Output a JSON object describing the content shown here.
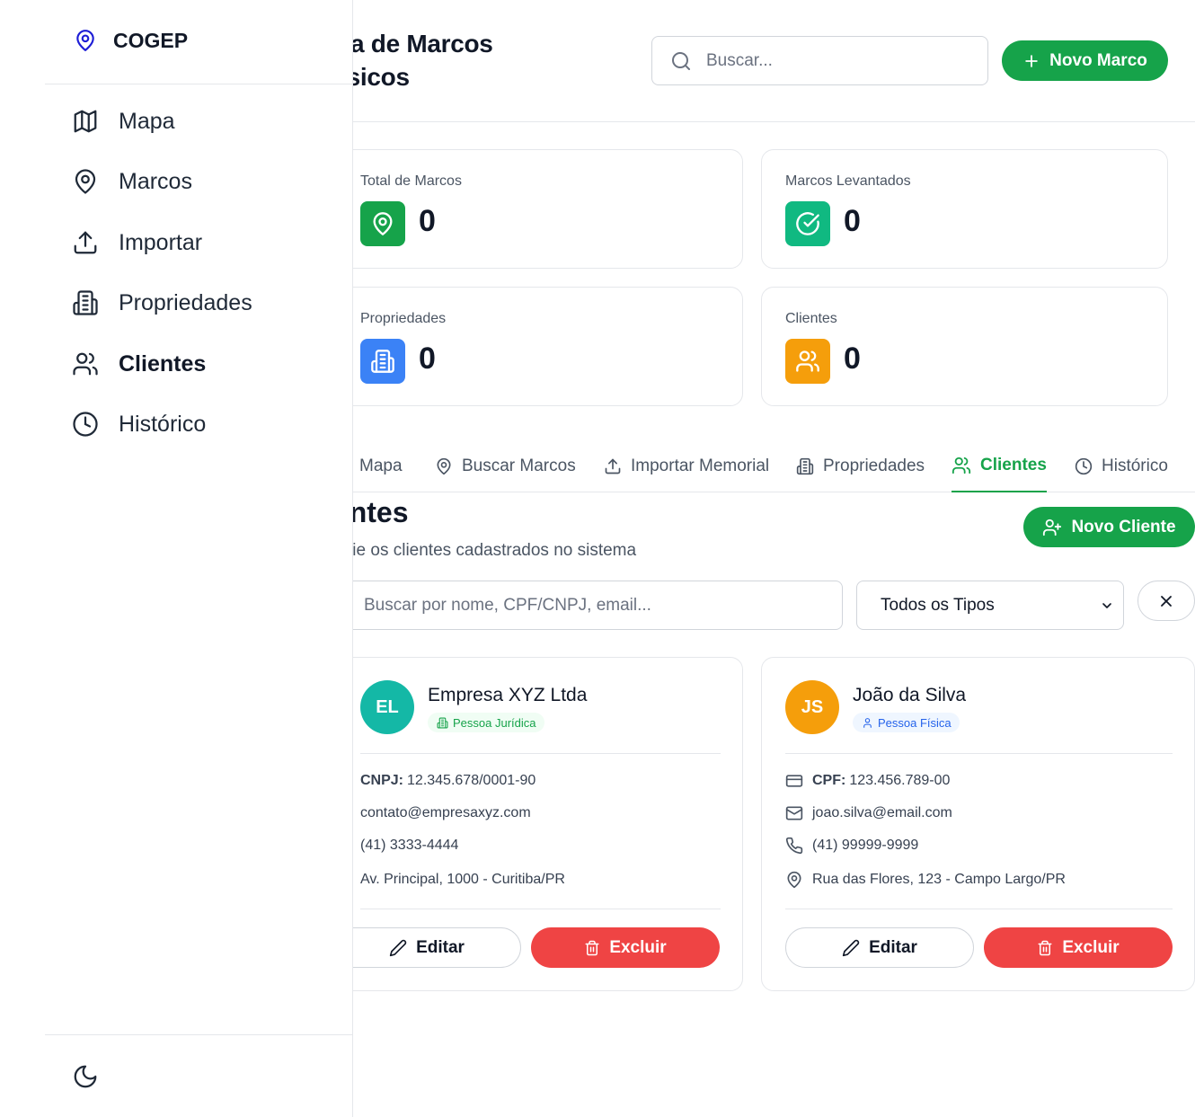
{
  "sidebar": {
    "brand": "COGEP",
    "items": [
      {
        "label": "Mapa"
      },
      {
        "label": "Marcos"
      },
      {
        "label": "Importar"
      },
      {
        "label": "Propriedades"
      },
      {
        "label": "Clientes"
      },
      {
        "label": "Histórico"
      }
    ],
    "active_item": "Clientes",
    "footer_icon": "moon-icon"
  },
  "header": {
    "title_line1": "Sistema de Marcos",
    "title_line2": "Geodésicos",
    "search_placeholder": "Buscar...",
    "new_button": "Novo Marco"
  },
  "stats": [
    {
      "label": "Total de Marcos",
      "value": "0",
      "icon": "map-pin-icon",
      "color": "#16a34a"
    },
    {
      "label": "Marcos Levantados",
      "value": "0",
      "icon": "check-circle-icon",
      "color": "#10b981"
    },
    {
      "label": "Propriedades",
      "value": "0",
      "icon": "building-icon",
      "color": "#3b82f6"
    },
    {
      "label": "Clientes",
      "value": "0",
      "icon": "users-icon",
      "color": "#f59e0b"
    }
  ],
  "tabs": [
    {
      "label": "Mapa"
    },
    {
      "label": "Buscar Marcos"
    },
    {
      "label": "Importar Memorial"
    },
    {
      "label": "Propriedades"
    },
    {
      "label": "Clientes"
    },
    {
      "label": "Histórico"
    }
  ],
  "clients_section": {
    "title": "Clientes",
    "subtitle": "Gerencie os clientes cadastrados no sistema",
    "new_button": "Novo Cliente",
    "search_placeholder": "Buscar por nome, CPF/CNPJ, email...",
    "type_filter": "Todos os Tipos"
  },
  "clients": [
    {
      "initials": "EL",
      "name": "Empresa XYZ Ltda",
      "type": "Pessoa Jurídica",
      "doc_label": "CNPJ:",
      "doc_value": "12.345.678/0001-90",
      "email": "contato@empresaxyz.com",
      "phone": "(41) 3333-4444",
      "address": "Av. Principal, 1000 - Curitiba/PR",
      "avatar_color": "#14b8a6",
      "edit_label": "Editar",
      "delete_label": "Excluir"
    },
    {
      "initials": "JS",
      "name": "João da Silva",
      "type": "Pessoa Física",
      "doc_label": "CPF:",
      "doc_value": "123.456.789-00",
      "email": "joao.silva@email.com",
      "phone": "(41) 99999-9999",
      "address": "Rua das Flores, 123 - Campo Largo/PR",
      "avatar_color": "#f59e0b",
      "edit_label": "Editar",
      "delete_label": "Excluir"
    }
  ]
}
